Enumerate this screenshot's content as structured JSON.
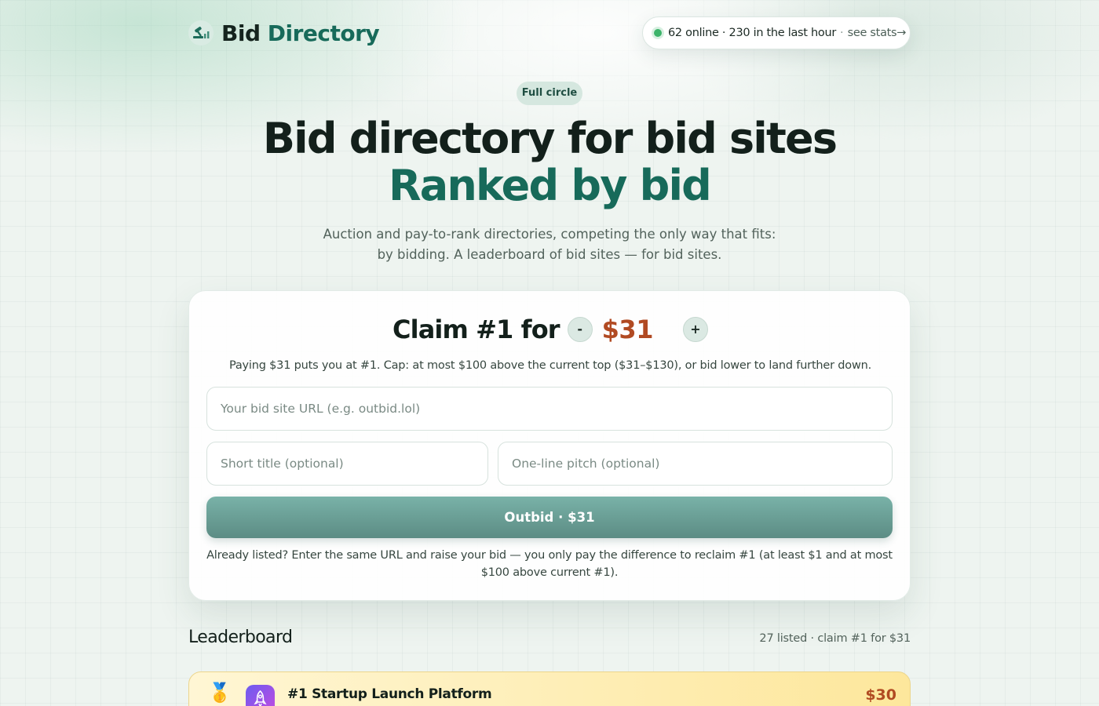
{
  "header": {
    "logo_word_1": "Bid",
    "logo_word_2": "Directory",
    "presence": {
      "main": "62 online · 230 in the last hour",
      "separator": "·",
      "link": "see stats→",
      "status_color": "#3cb46a"
    }
  },
  "hero": {
    "pill": "Full circle",
    "title_line_1": "Bid directory for bid sites",
    "title_line_2": "Ranked by bid",
    "lead": "Auction and pay-to-rank directories, competing the only way that fits: by bidding. A leaderboard of bid sites — for bid sites."
  },
  "claim": {
    "label": "Claim #1 for",
    "decrement": "-",
    "price": "$31",
    "increment": "+",
    "note": "Paying $31 puts you at #1. Cap: at most $100 above the current top ($31–$130), or bid lower to land further down.",
    "url_placeholder": "Your bid site URL (e.g. outbid.lol)",
    "title_placeholder": "Short title (optional)",
    "pitch_placeholder": "One-line pitch (optional)",
    "submit": "Outbid · $31",
    "footnote": "Already listed? Enter the same URL and raise your bid — you only pay the difference to reclaim #1 (at least $1 and at most $100 above current #1)."
  },
  "leaderboard": {
    "title": "Leaderboard",
    "meta": "27 listed · claim #1 for $31",
    "rows": [
      {
        "medal": "🥇",
        "icon": "rocket-icon",
        "name": "#1 Startup Launch Platform",
        "price": "$30"
      }
    ]
  },
  "colors": {
    "brand": "#176a5a",
    "price_accent": "#b14a22",
    "button": "#6a9e95"
  }
}
